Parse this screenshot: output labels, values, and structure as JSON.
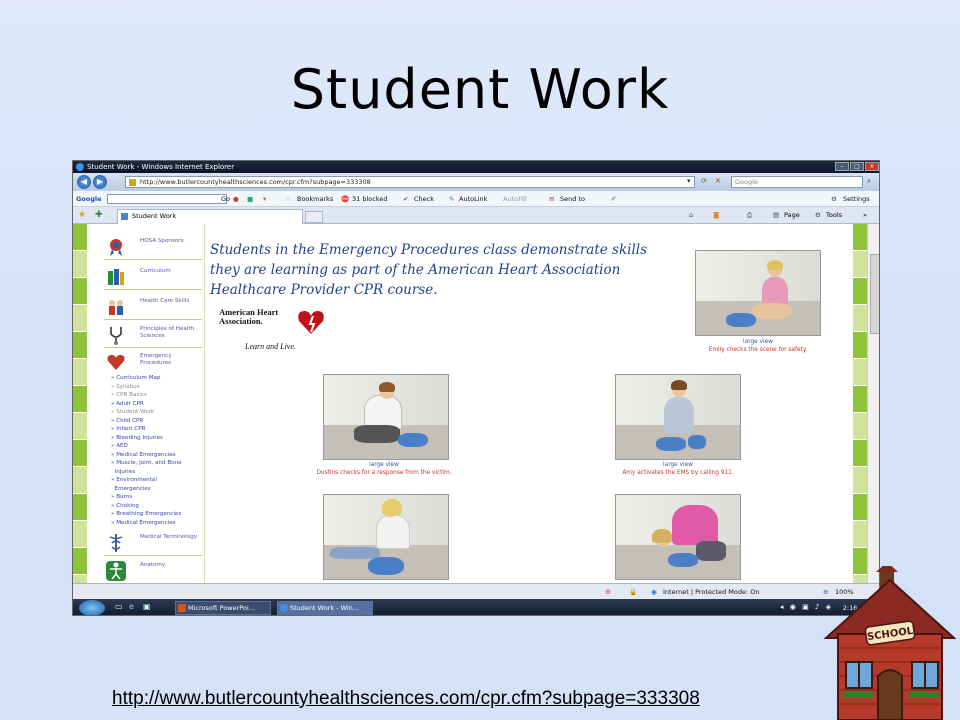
{
  "slide": {
    "title": "Student Work",
    "footer_url": "http://www.butlercountyhealthsciences.com/cpr.cfm?subpage=333308"
  },
  "browser": {
    "window_title": "Student Work - Windows Internet Explorer",
    "address": "http://www.butlercountyhealthsciences.com/cpr.cfm?subpage=333308",
    "search_placeholder": "Google",
    "toolbar": {
      "google_label": "Google",
      "go_label": "Go",
      "bookmarks_label": "Bookmarks",
      "blocked_label": "31 blocked",
      "check_label": "Check",
      "autolink_label": "AutoLink",
      "autofill_label": "AutoFill",
      "sendto_label": "Send to",
      "settings_label": "Settings"
    },
    "tab_label": "Student Work",
    "command": {
      "page_label": "Page",
      "tools_label": "Tools"
    },
    "status": {
      "zone": "Internet | Protected Mode: On",
      "zoom": "100%"
    },
    "taskbar": {
      "task1": "Microsoft PowerPoi...",
      "task2": "Student Work - Win...",
      "clock": "2:16 PM"
    }
  },
  "page": {
    "nav": [
      {
        "label": "HOSA Sponsors",
        "icon": "ribbon-icon"
      },
      {
        "label": "Curriculum",
        "icon": "books-icon"
      },
      {
        "label": "Health Care Skills",
        "icon": "people-icon"
      },
      {
        "label": "Principles of Health Sciences",
        "icon": "stethoscope-icon"
      },
      {
        "label": "Emergency Procedures",
        "icon": "heart-icon"
      },
      {
        "label": "Medical Terminology",
        "icon": "caduceus-icon"
      },
      {
        "label": "Anatomy",
        "icon": "anatomy-icon"
      }
    ],
    "subnav": [
      "Curriculum Map",
      "Syllabus",
      "CPR Basics",
      "Adult CPR",
      "Student Work",
      "Child CPR",
      "Infant CPR",
      "Bleeding Injuries",
      "AED",
      "Medical Emergencies",
      "Muscle, Joint, and Bone",
      "Injuries",
      "Environmental",
      "Emergencies",
      "Burns",
      "Choking",
      "Breathing Emergencies",
      "Medical Emergencies"
    ],
    "heading": "Students in the Emergency Procedures class demonstrate skills they are learning as part of the American Heart Association Healthcare Provider CPR course.",
    "aha": {
      "name": "American Heart Association.",
      "tagline": "Learn and Live."
    },
    "photos": [
      {
        "link": "large view",
        "caption": "Emily checks the scene for safety."
      },
      {
        "link": "large view",
        "caption": "Dustins checks for a response from the victim."
      },
      {
        "link": "large view",
        "caption": "Amy activates the EMS by calling 911."
      }
    ]
  },
  "colors": {
    "stripe_green": "#8fc33a",
    "stripe_light": "#cfe39a",
    "heading_blue": "#22428f",
    "caption_red": "#c0392b",
    "link_blue": "#3355bb"
  }
}
